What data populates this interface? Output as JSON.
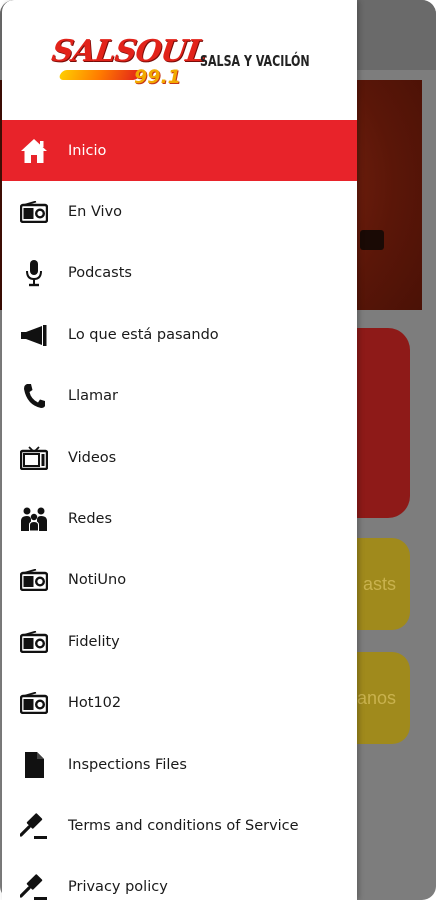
{
  "brand": {
    "name": "SALSOUL",
    "frequency": "99.1",
    "tagline": "SALSA Y VACILÓN"
  },
  "colors": {
    "accent": "#e8232a",
    "icon": "#111111",
    "text": "#1a1a1a",
    "overlay": "#7d7d7d"
  },
  "menu": {
    "items": [
      {
        "label": "Inicio",
        "icon": "home-icon",
        "active": true
      },
      {
        "label": "En Vivo",
        "icon": "radio-icon",
        "active": false
      },
      {
        "label": "Podcasts",
        "icon": "microphone-icon",
        "active": false
      },
      {
        "label": "Lo que está pasando",
        "icon": "megaphone-icon",
        "active": false
      },
      {
        "label": "Llamar",
        "icon": "phone-icon",
        "active": false
      },
      {
        "label": "Videos",
        "icon": "tv-icon",
        "active": false
      },
      {
        "label": "Redes",
        "icon": "users-icon",
        "active": false
      },
      {
        "label": "NotiUno",
        "icon": "radio-icon",
        "active": false
      },
      {
        "label": "Fidelity",
        "icon": "radio-icon",
        "active": false
      },
      {
        "label": "Hot102",
        "icon": "radio-icon",
        "active": false
      },
      {
        "label": "Inspections Files",
        "icon": "file-icon",
        "active": false
      },
      {
        "label": "Terms and conditions of Service",
        "icon": "gavel-icon",
        "active": false
      },
      {
        "label": "Privacy policy",
        "icon": "gavel-icon",
        "active": false
      }
    ]
  },
  "background": {
    "card_labels": [
      "asts",
      "anos"
    ]
  }
}
